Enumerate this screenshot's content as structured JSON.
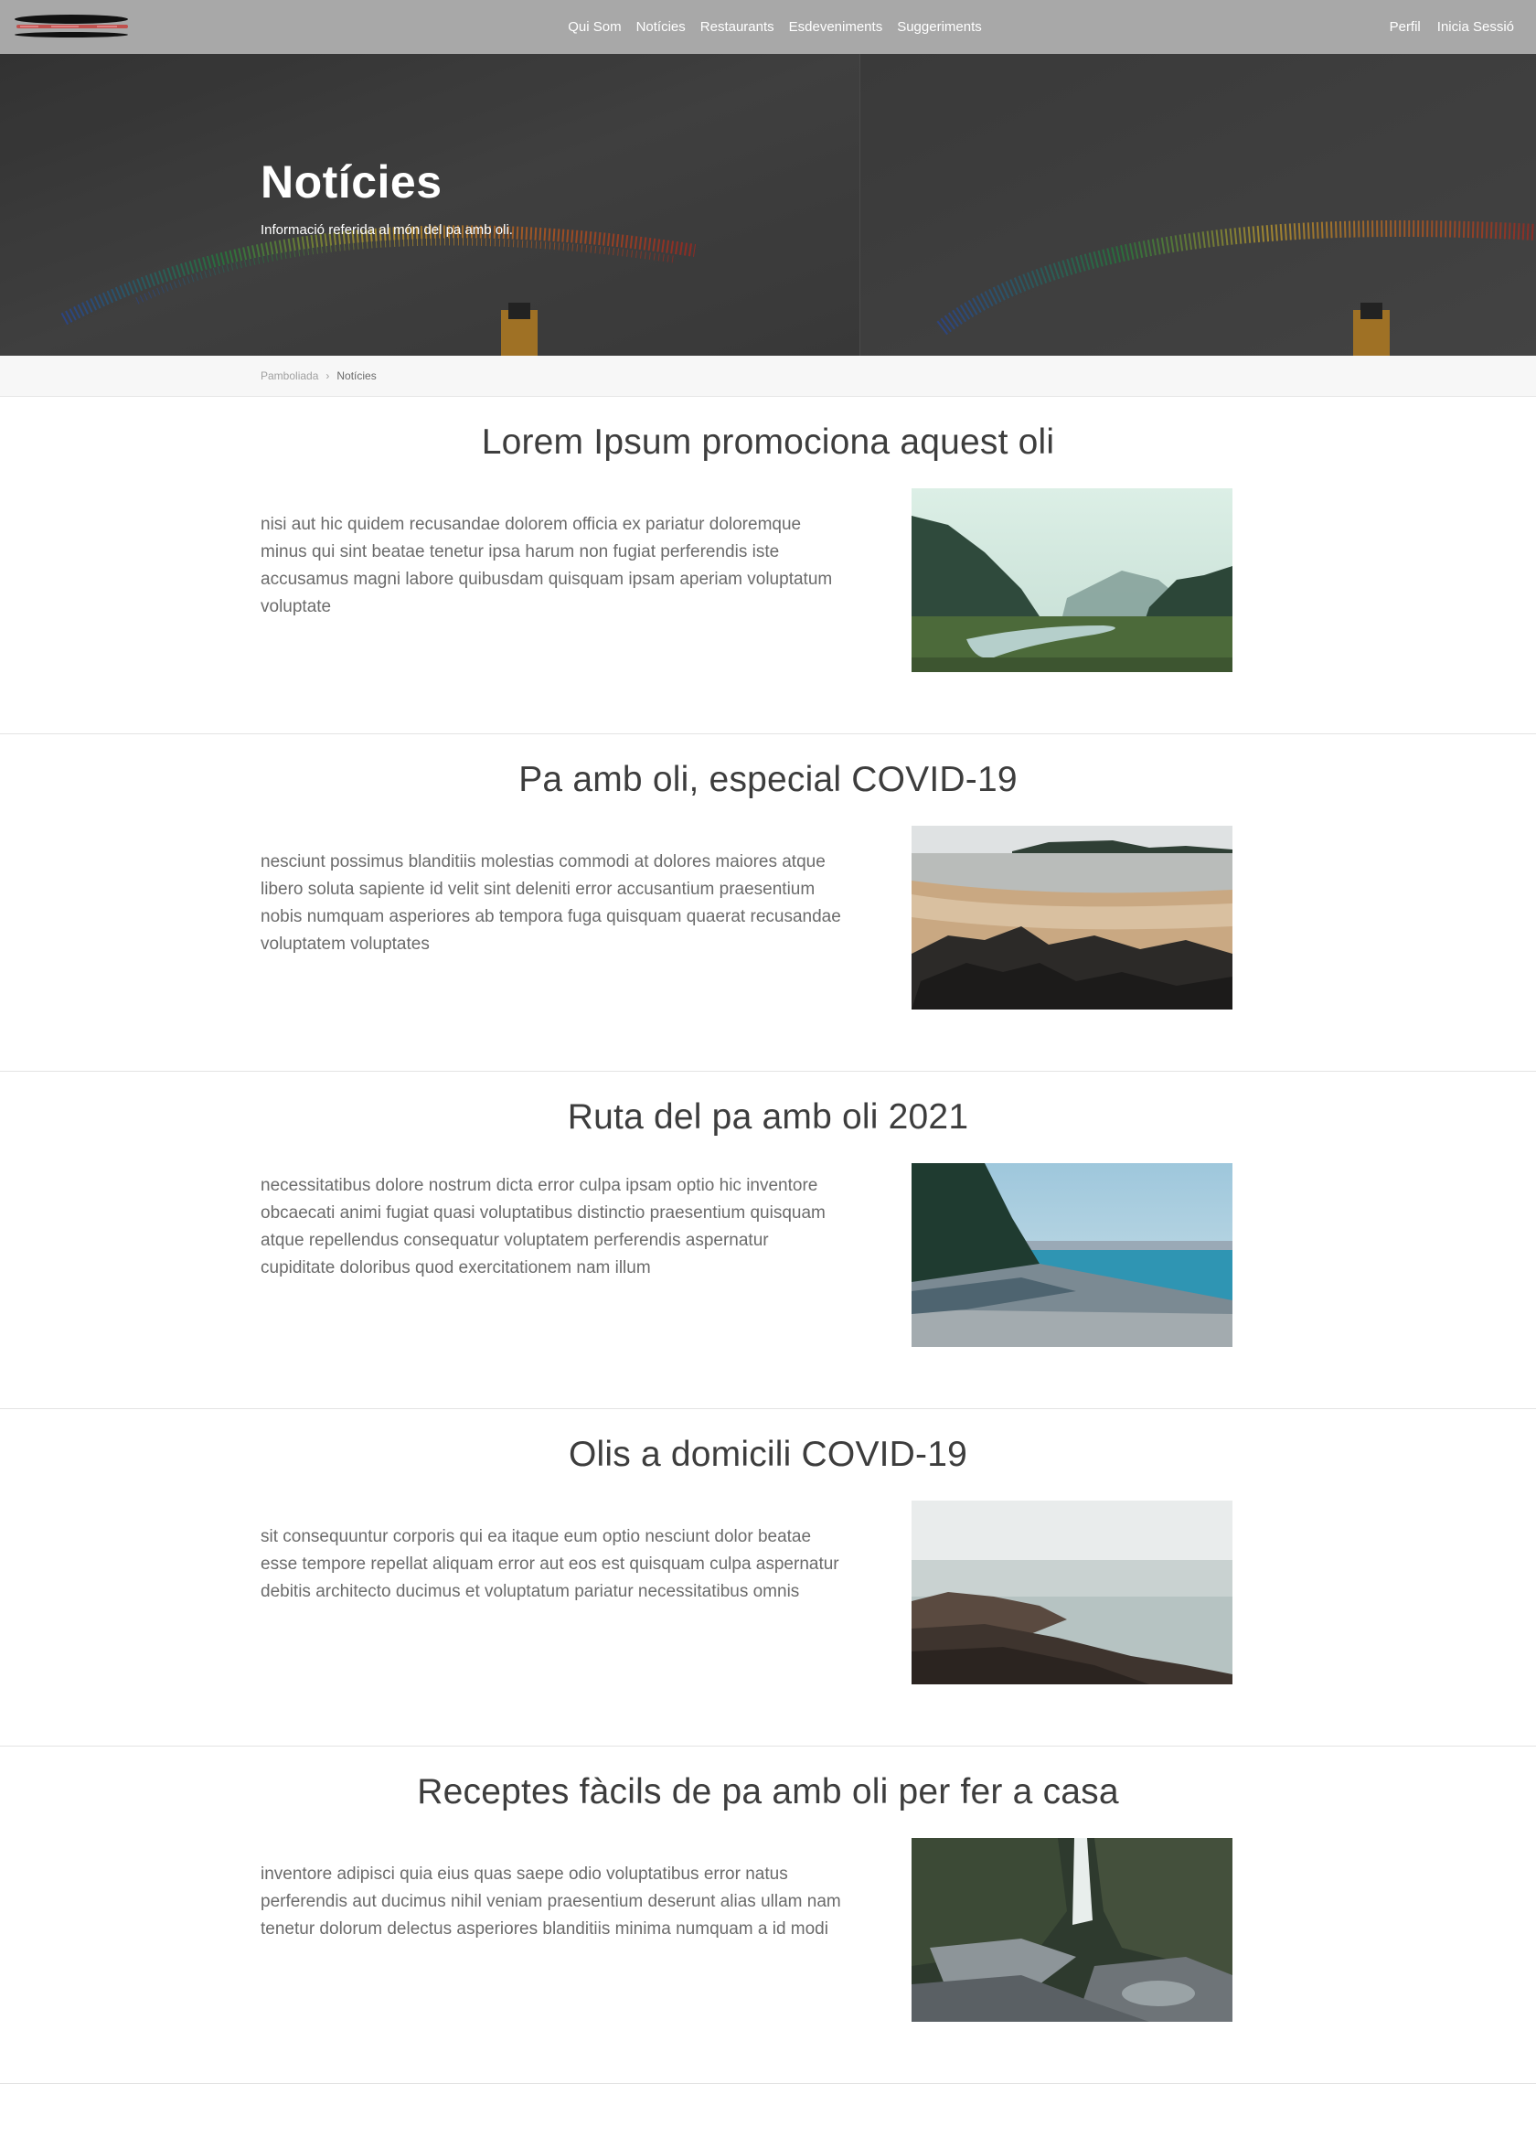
{
  "nav": {
    "items": [
      "Qui Som",
      "Notícies",
      "Restaurants",
      "Esdeveniments",
      "Suggeriments"
    ],
    "right": [
      "Perfil",
      "Inicia Sessió"
    ]
  },
  "hero": {
    "title": "Notícies",
    "subtitle": "Informació referida al món del pa amb oli."
  },
  "breadcrumb": {
    "home": "Pamboliada",
    "separator": "›",
    "current": "Notícies"
  },
  "articles": [
    {
      "title": "Lorem Ipsum promociona aquest oli",
      "text": "nisi aut hic quidem recusandae dolorem officia ex pariatur doloremque minus qui sint beatae tenetur ipsa harum non fugiat perferendis iste accusamus magni labore quibusdam quisquam ipsam aperiam voluptatum voluptate",
      "image": "forest-valley-river"
    },
    {
      "title": "Pa amb oli, especial COVID-19",
      "text": "nesciunt possimus blanditiis molestias commodi at dolores maiores atque libero soluta sapiente id velit sint deleniti error accusantium praesentium nobis numquam asperiores ab tempora fuga quisquam quaerat recusandae voluptatem voluptates",
      "image": "beach-rocks"
    },
    {
      "title": "Ruta del pa amb oli 2021",
      "text": "necessitatibus dolore nostrum dicta error culpa ipsam optio hic inventore obcaecati animi fugiat quasi voluptatibus distinctio praesentium quisquam atque repellendus consequatur voluptatem perferendis aspernatur cupiditate doloribus quod exercitationem nam illum",
      "image": "pebble-shore"
    },
    {
      "title": "Olis a domicili COVID-19",
      "text": "sit consequuntur corporis qui ea itaque eum optio nesciunt dolor beatae esse tempore repellat aliquam error aut eos est quisquam culpa aspernatur debitis architecto ducimus et voluptatum pariatur necessitatibus omnis",
      "image": "rocky-sea"
    },
    {
      "title": "Receptes fàcils de pa amb oli per fer a casa",
      "text": "inventore adipisci quia eius quas saepe odio voluptatibus error natus perferendis aut ducimus nihil veniam praesentium deserunt alias ullam nam tenetur dolorum delectus asperiores blanditiis minima numquam a id modi",
      "image": "waterfall-canyon"
    }
  ]
}
